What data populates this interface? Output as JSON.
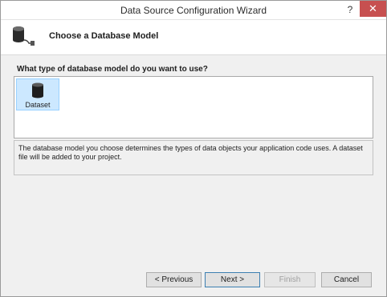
{
  "window": {
    "title": "Data Source Configuration Wizard",
    "help_glyph": "?",
    "close_glyph": "✕"
  },
  "header": {
    "icon": "database-connection-icon",
    "title": "Choose a Database Model"
  },
  "main": {
    "question": "What type of database model do you want to use?",
    "models": [
      {
        "label": "Dataset",
        "icon": "database-icon",
        "selected": true
      }
    ],
    "description": "The database model you choose determines the types of data objects your application code uses. A dataset file will be added to your project."
  },
  "buttons": {
    "previous": "< Previous",
    "next": "Next >",
    "finish": "Finish",
    "cancel": "Cancel"
  },
  "colors": {
    "close_button": "#c75050",
    "selection": "#cce8ff",
    "default_button_border": "#3c7fb1"
  }
}
